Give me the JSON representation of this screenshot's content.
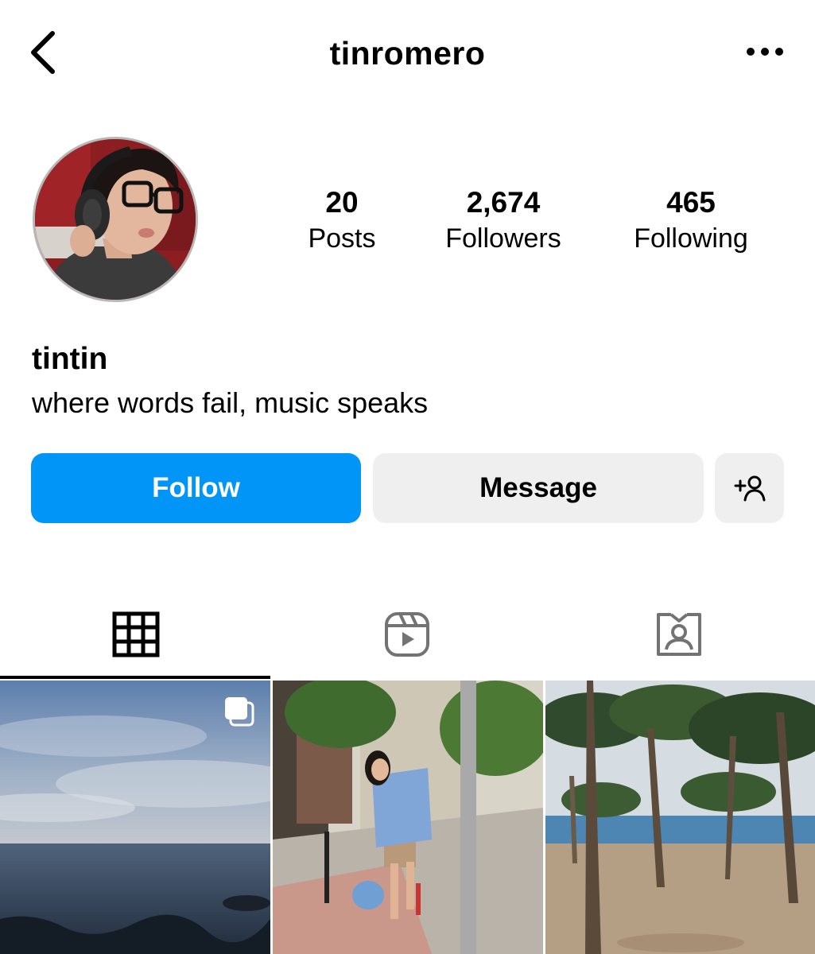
{
  "header": {
    "username": "tinromero",
    "back_icon": "chevron-left-icon",
    "more_icon": "more-horizontal-icon"
  },
  "profile": {
    "stats": {
      "posts_count": "20",
      "posts_label": "Posts",
      "followers_count": "2,674",
      "followers_label": "Followers",
      "following_count": "465",
      "following_label": "Following"
    },
    "display_name": "tintin",
    "bio": "where words fail, music speaks"
  },
  "actions": {
    "follow_label": "Follow",
    "message_label": "Message",
    "add_user_icon": "person-add-icon"
  },
  "tabs": [
    {
      "icon": "grid-icon",
      "active": true
    },
    {
      "icon": "reels-icon",
      "active": false
    },
    {
      "icon": "tagged-icon",
      "active": false
    }
  ],
  "posts": [
    {
      "type": "carousel",
      "icon": "multiple-images-icon"
    },
    {
      "type": "image"
    },
    {
      "type": "image"
    }
  ],
  "colors": {
    "follow_button": "#0095f6",
    "secondary_button": "#efefef",
    "text": "#000000"
  }
}
